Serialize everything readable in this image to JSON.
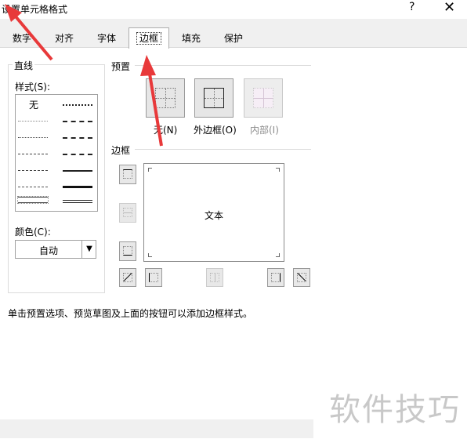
{
  "title": "设置单元格格式",
  "help_label": "?",
  "close_label": "✕",
  "tabs": [
    "数字",
    "对齐",
    "字体",
    "边框",
    "填充",
    "保护"
  ],
  "line_group": {
    "heading": "直线",
    "style_label": "样式(S):",
    "none_label": "无",
    "color_label": "颜色(C):",
    "color_value": "自动"
  },
  "presets": {
    "heading": "预置",
    "none": "无(N)",
    "outline": "外边框(O)",
    "inside": "内部(I)"
  },
  "border": {
    "heading": "边框",
    "preview_text": "文本"
  },
  "hint": "单击预置选项、预览草图及上面的按钮可以添加边框样式。",
  "watermark": "软件技巧",
  "colors": {
    "arrow": "#e8393a",
    "tab_border": "#adadad"
  }
}
